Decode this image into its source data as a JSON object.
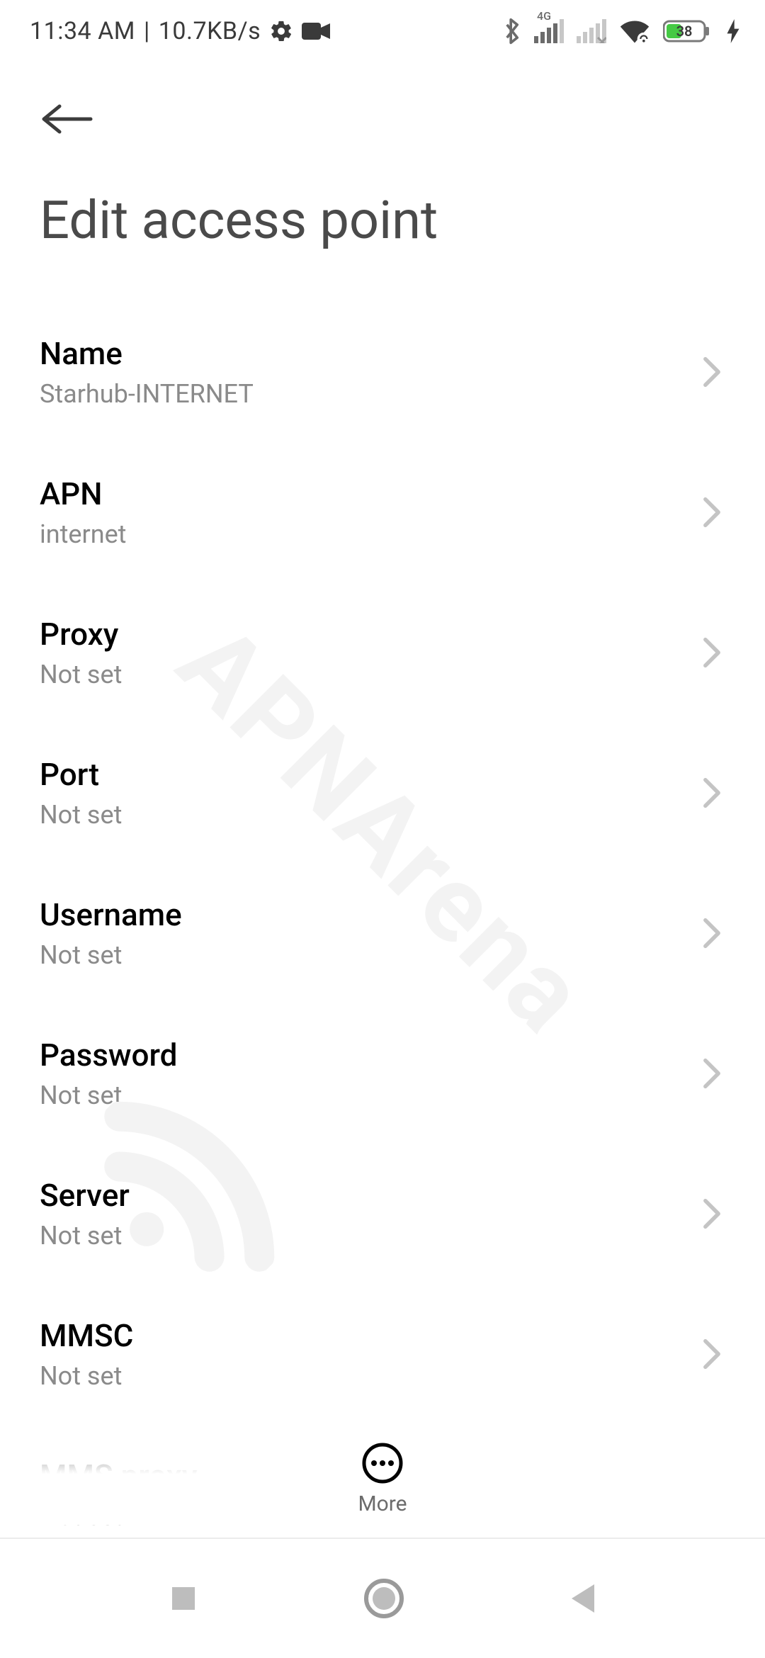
{
  "status": {
    "time": "11:34 AM",
    "sep": "|",
    "speed": "10.7KB/s",
    "network_badge": "4G",
    "battery_pct": "38"
  },
  "page_title": "Edit access point",
  "rows": [
    {
      "label": "Name",
      "value": "Starhub-INTERNET"
    },
    {
      "label": "APN",
      "value": "internet"
    },
    {
      "label": "Proxy",
      "value": "Not set"
    },
    {
      "label": "Port",
      "value": "Not set"
    },
    {
      "label": "Username",
      "value": "Not set"
    },
    {
      "label": "Password",
      "value": "Not set"
    },
    {
      "label": "Server",
      "value": "Not set"
    },
    {
      "label": "MMSC",
      "value": "Not set"
    },
    {
      "label": "MMS proxy",
      "value": "Not set"
    }
  ],
  "more_label": "More",
  "watermark": "APNArena"
}
